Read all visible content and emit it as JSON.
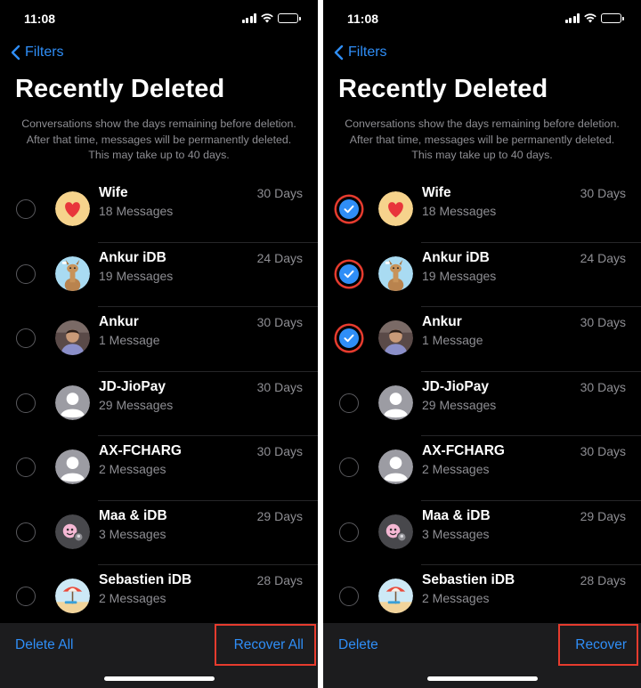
{
  "screens": [
    {
      "status_time": "11:08",
      "back_label": "Filters",
      "title": "Recently Deleted",
      "description": "Conversations show the days remaining before deletion. After that time, messages will be permanently deleted. This may take up to 40 days.",
      "items": [
        {
          "name": "Wife",
          "count": "18 Messages",
          "days": "30 Days",
          "checked": false,
          "avatar": "heart-icon"
        },
        {
          "name": "Ankur iDB",
          "count": "19 Messages",
          "days": "24 Days",
          "checked": false,
          "avatar": "llama-icon"
        },
        {
          "name": "Ankur",
          "count": "1 Message",
          "days": "30 Days",
          "checked": false,
          "avatar": "person-photo-icon"
        },
        {
          "name": "JD-JioPay",
          "count": "29 Messages",
          "days": "30 Days",
          "checked": false,
          "avatar": "person-icon"
        },
        {
          "name": "AX-FCHARG",
          "count": "2 Messages",
          "days": "30 Days",
          "checked": false,
          "avatar": "person-icon"
        },
        {
          "name": "Maa & iDB",
          "count": "3 Messages",
          "days": "29 Days",
          "checked": false,
          "avatar": "group-emoji-icon"
        },
        {
          "name": "Sebastien iDB",
          "count": "2 Messages",
          "days": "28 Days",
          "checked": false,
          "avatar": "beach-icon"
        }
      ],
      "toolbar": {
        "left_label": "Delete All",
        "right_label": "Recover All"
      }
    },
    {
      "status_time": "11:08",
      "back_label": "Filters",
      "title": "Recently Deleted",
      "description": "Conversations show the days remaining before deletion. After that time, messages will be permanently deleted. This may take up to 40 days.",
      "items": [
        {
          "name": "Wife",
          "count": "18 Messages",
          "days": "30 Days",
          "checked": true,
          "avatar": "heart-icon"
        },
        {
          "name": "Ankur iDB",
          "count": "19 Messages",
          "days": "24 Days",
          "checked": true,
          "avatar": "llama-icon"
        },
        {
          "name": "Ankur",
          "count": "1 Message",
          "days": "30 Days",
          "checked": true,
          "avatar": "person-photo-icon"
        },
        {
          "name": "JD-JioPay",
          "count": "29 Messages",
          "days": "30 Days",
          "checked": false,
          "avatar": "person-icon"
        },
        {
          "name": "AX-FCHARG",
          "count": "2 Messages",
          "days": "30 Days",
          "checked": false,
          "avatar": "person-icon"
        },
        {
          "name": "Maa & iDB",
          "count": "3 Messages",
          "days": "29 Days",
          "checked": false,
          "avatar": "group-emoji-icon"
        },
        {
          "name": "Sebastien iDB",
          "count": "2 Messages",
          "days": "28 Days",
          "checked": false,
          "avatar": "beach-icon"
        }
      ],
      "toolbar": {
        "left_label": "Delete",
        "right_label": "Recover"
      }
    }
  ],
  "colors": {
    "accent": "#2f8ef7",
    "highlight": "#e63b2e",
    "secondary_text": "#8e8e93",
    "background": "#000000",
    "toolbar": "#1c1c1e"
  }
}
